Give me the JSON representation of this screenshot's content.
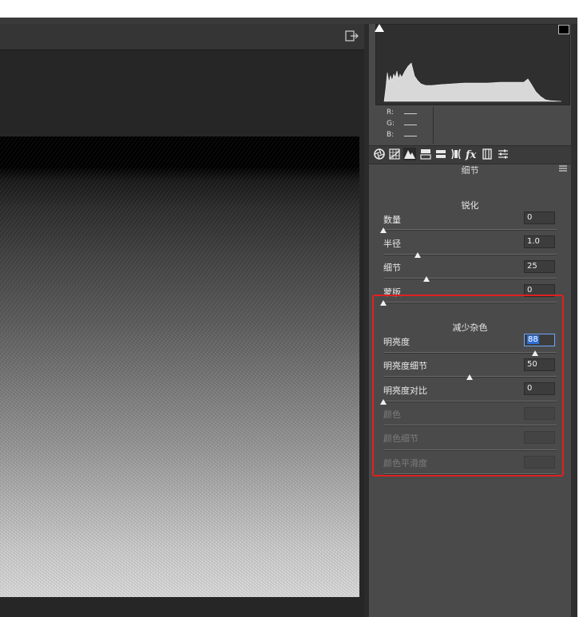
{
  "rgb": {
    "r_label": "R:",
    "g_label": "G:",
    "b_label": "B:"
  },
  "panel": {
    "title": "细节"
  },
  "sharpening": {
    "title": "锐化",
    "rows": [
      {
        "label": "数量",
        "value": "0",
        "pos": 0
      },
      {
        "label": "半径",
        "value": "1.0",
        "pos": 0.2
      },
      {
        "label": "细节",
        "value": "25",
        "pos": 0.25
      },
      {
        "label": "蒙版",
        "value": "0",
        "pos": 0
      }
    ]
  },
  "noise_reduction": {
    "title": "减少杂色",
    "rows": [
      {
        "label": "明亮度",
        "value": "88",
        "pos": 0.88
      },
      {
        "label": "明亮度细节",
        "value": "50",
        "pos": 0.5
      },
      {
        "label": "明亮度对比",
        "value": "0",
        "pos": 0
      },
      {
        "label": "颜色",
        "value": ""
      },
      {
        "label": "颜色细节",
        "value": ""
      },
      {
        "label": "颜色平滑度",
        "value": ""
      }
    ]
  },
  "tabs": [
    "basic-aperture-icon",
    "tone-curve-icon",
    "detail-icon",
    "hsl-icon",
    "split-toning-icon",
    "lens-icon",
    "fx-icon",
    "camera-calibration-icon",
    "presets-icon"
  ],
  "colors": {
    "highlight": "#e02020",
    "accent": "#2f6ed6"
  }
}
